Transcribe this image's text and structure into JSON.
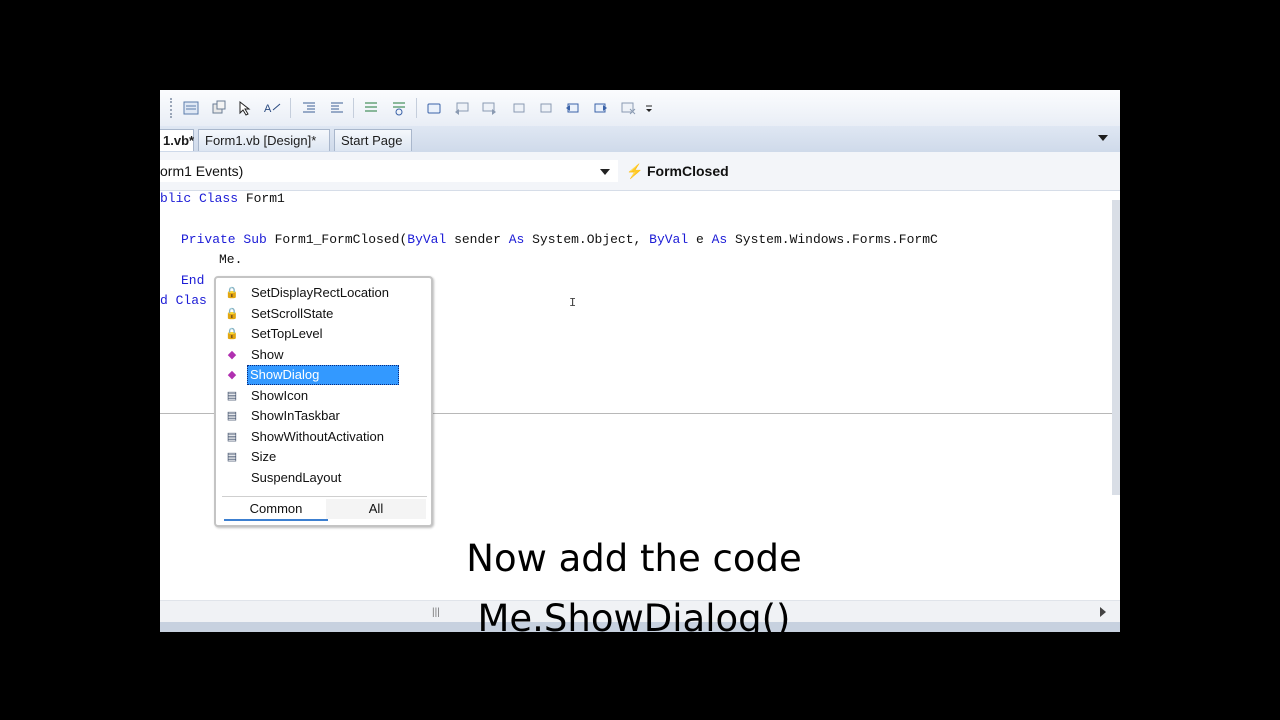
{
  "tabs": [
    {
      "label": "1.vb*",
      "active": true
    },
    {
      "label": "Form1.vb [Design]*",
      "active": false
    },
    {
      "label": "Start Page",
      "active": false
    }
  ],
  "navbar": {
    "left_combo": "orm1 Events)",
    "right_combo": "FormClosed"
  },
  "code": {
    "line1": {
      "kw": "blic Class",
      "rest": " Form1"
    },
    "line2": {
      "kw1": "Private Sub",
      "mid1": " Form1_FormClosed(",
      "kw2": "ByVal",
      "mid2": " sender ",
      "kw3": "As",
      "mid3": " System.Object, ",
      "kw4": "ByVal",
      "mid4": " e ",
      "kw5": "As",
      "mid5": " System.Windows.Forms.FormC"
    },
    "line3": "Me.",
    "line4": "End",
    "line5": "d Clas"
  },
  "intellisense": {
    "items": [
      {
        "label": "SetDisplayRectLocation",
        "icon": "protected-method-icon"
      },
      {
        "label": "SetScrollState",
        "icon": "protected-method-icon"
      },
      {
        "label": "SetTopLevel",
        "icon": "protected-method-icon"
      },
      {
        "label": "Show",
        "icon": "method-icon"
      },
      {
        "label": "ShowDialog",
        "icon": "method-icon",
        "selected": true
      },
      {
        "label": "ShowIcon",
        "icon": "property-icon"
      },
      {
        "label": "ShowInTaskbar",
        "icon": "property-icon"
      },
      {
        "label": "ShowWithoutActivation",
        "icon": "property-icon"
      },
      {
        "label": "Size",
        "icon": "property-icon"
      },
      {
        "label": "SuspendLayout",
        "icon": "method-icon"
      }
    ],
    "tab_common": "Common",
    "tab_all": "All"
  },
  "caption": {
    "line1": "Now add the code",
    "line2": "Me.ShowDialog()"
  },
  "colors": {
    "keyword": "#1b1bd6",
    "selection": "#3399ff"
  }
}
